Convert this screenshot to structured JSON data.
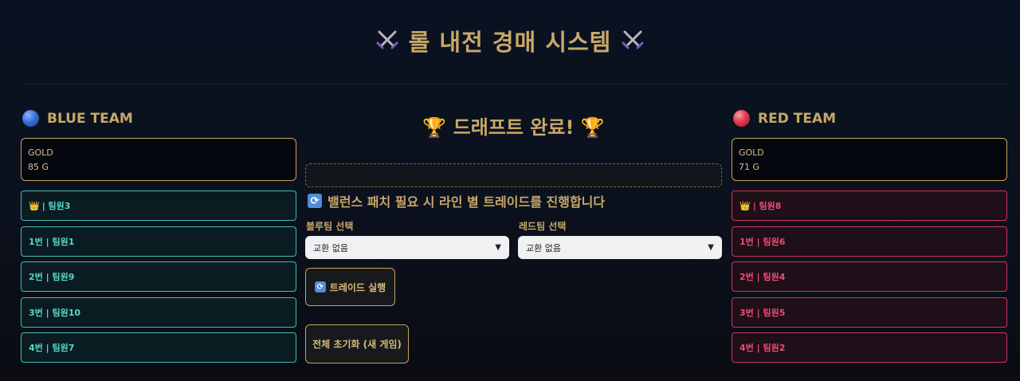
{
  "header": {
    "title": "롤 내전 경매 시스템",
    "title_icon": "crossed-swords-icon"
  },
  "blue_team": {
    "name": "BLUE TEAM",
    "gold_label": "GOLD",
    "gold_value": "85 G",
    "slots": [
      {
        "label": "| 팀원3",
        "leader": true
      },
      {
        "label": "1번 | 팀원1"
      },
      {
        "label": "2번 | 팀원9"
      },
      {
        "label": "3번 | 팀원10"
      },
      {
        "label": "4번 | 팀원7"
      }
    ]
  },
  "red_team": {
    "name": "RED TEAM",
    "gold_label": "GOLD",
    "gold_value": "71 G",
    "slots": [
      {
        "label": "| 팀원8",
        "leader": true
      },
      {
        "label": "1번 | 팀원6"
      },
      {
        "label": "2번 | 팀원4"
      },
      {
        "label": "3번 | 팀원5"
      },
      {
        "label": "4번 | 팀원2"
      }
    ]
  },
  "center": {
    "draft_title": "드래프트 완료!",
    "notice": "밸런스 패치 필요 시 라인 별 트레이드를 진행합니다",
    "blue_select_label": "블루팀 선택",
    "red_select_label": "레드팀 선택",
    "blue_select_value": "교환 없음",
    "red_select_value": "교환 없음",
    "trade_button": "트레이드 실행",
    "reset_button": "전체 초기화 (새 게임)"
  },
  "colors": {
    "gold": "#c8a868",
    "blue_border": "#3fbfb4",
    "red_border": "#d2335e"
  }
}
